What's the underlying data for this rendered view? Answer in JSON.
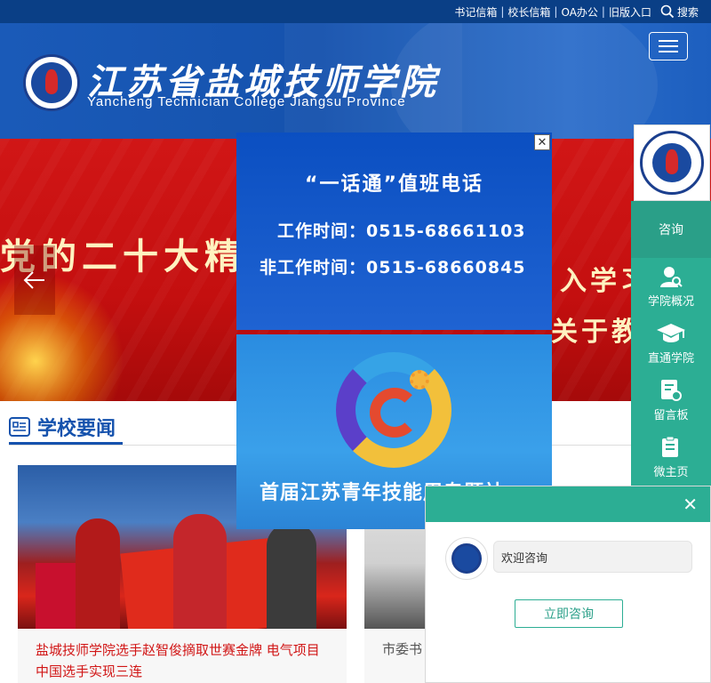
{
  "topbar": {
    "links": [
      "书记信箱",
      "校长信箱",
      "OA办公",
      "旧版入口"
    ],
    "search_label": "搜索"
  },
  "header": {
    "title": "江苏省盐城技师学院",
    "subtitle": "Yancheng Technician College Jiangsu Province"
  },
  "banner": {
    "text_left": "党的二十大精神",
    "text_right_1": "入学习",
    "text_right_2": "关于教"
  },
  "news": {
    "section_title": "学校要闻",
    "cards": [
      {
        "caption": "盐城技师学院选手赵智俊摘取世赛金牌 电气项目中国选手实现三连"
      },
      {
        "caption": "市委书"
      }
    ]
  },
  "popup": {
    "title": "“一话通”值班电话",
    "work_hours": "工作时间：0515-68661103",
    "off_hours": "非工作时间：0515-68660845",
    "bottom_title": "首届江苏青年技能周专题站",
    "close_glyph": "✕"
  },
  "side_panel": {
    "consult_label": "咨询",
    "items": [
      {
        "label": "学院概况",
        "icon": "user-search-icon"
      },
      {
        "label": "直通学院",
        "icon": "graduation-cap-icon"
      },
      {
        "label": "留言板",
        "icon": "message-board-icon"
      },
      {
        "label": "微主页",
        "icon": "micro-home-icon"
      }
    ]
  },
  "chat": {
    "close_glyph": "✕",
    "greeting": "欢迎咨询",
    "button_label": "立即咨询"
  },
  "colors": {
    "brand_blue": "#1552ad",
    "banner_red": "#d11616",
    "teal": "#2cae94"
  }
}
